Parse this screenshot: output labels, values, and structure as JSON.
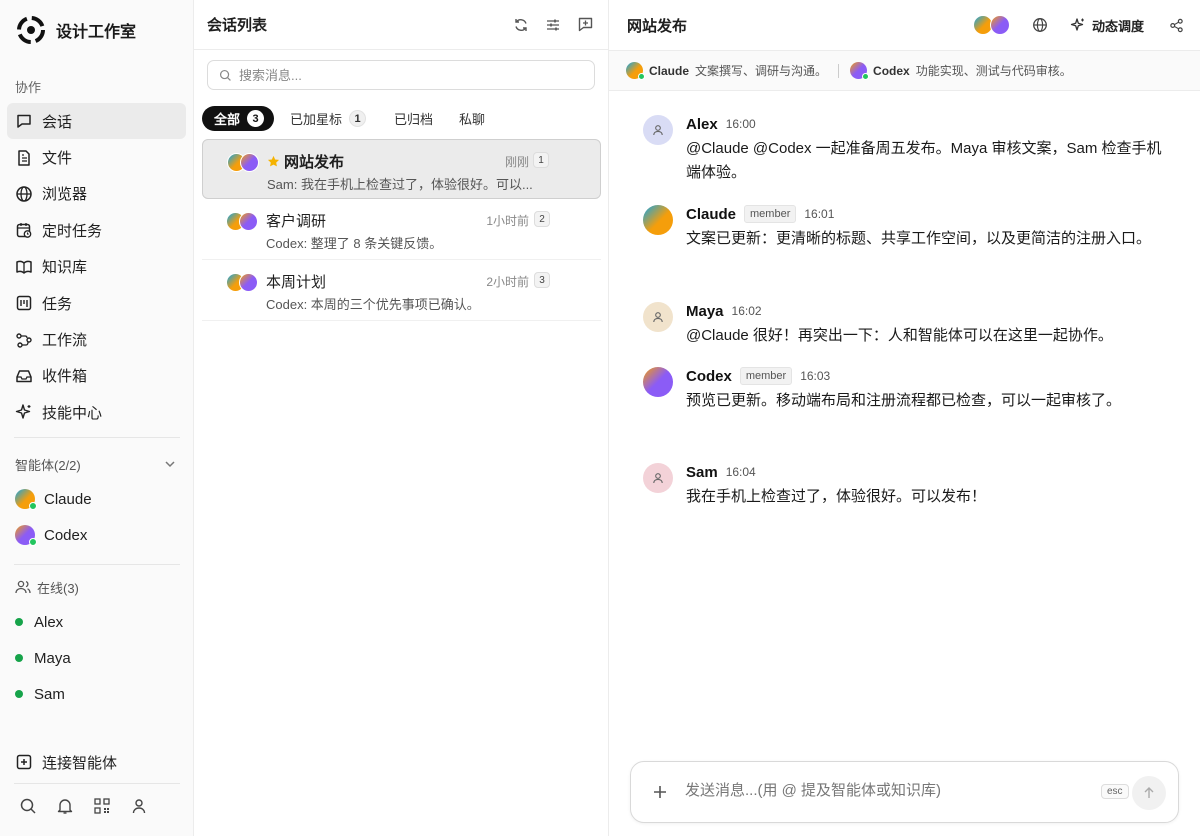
{
  "sidebar": {
    "brand": "设计工作室",
    "section_label": "协作",
    "nav": [
      {
        "label": "会话",
        "icon": "chat-icon"
      },
      {
        "label": "文件",
        "icon": "file-icon"
      },
      {
        "label": "浏览器",
        "icon": "globe-icon"
      },
      {
        "label": "定时任务",
        "icon": "calendar-clock-icon"
      },
      {
        "label": "知识库",
        "icon": "book-icon"
      },
      {
        "label": "任务",
        "icon": "kanban-icon"
      },
      {
        "label": "工作流",
        "icon": "workflow-icon"
      },
      {
        "label": "收件箱",
        "icon": "inbox-icon"
      },
      {
        "label": "技能中心",
        "icon": "sparkles-icon"
      }
    ],
    "agents_label": "智能体(2/2)",
    "agents": [
      {
        "name": "Claude",
        "color": "#f59e0b"
      },
      {
        "name": "Codex",
        "color": "#8b5cf6"
      }
    ],
    "online_label": "在线(3)",
    "online_users": [
      "Alex",
      "Maya",
      "Sam"
    ],
    "connect_label": "连接智能体"
  },
  "list": {
    "title": "会话列表",
    "search_placeholder": "搜索消息...",
    "tabs": [
      {
        "label": "全部",
        "count": "3"
      },
      {
        "label": "已加星标",
        "count": "1"
      },
      {
        "label": "已归档",
        "count": ""
      },
      {
        "label": "私聊",
        "count": ""
      }
    ],
    "conversations": [
      {
        "title": "网站发布",
        "preview": "Sam: 我在手机上检查过了，体验很好。可以...",
        "time": "刚刚",
        "count": "1",
        "starred": true
      },
      {
        "title": "客户调研",
        "preview": "Codex: 整理了 8 条关键反馈。",
        "time": "1小时前",
        "count": "2",
        "starred": false
      },
      {
        "title": "本周计划",
        "preview": "Codex: 本周的三个优先事项已确认。",
        "time": "2小时前",
        "count": "3",
        "starred": false
      }
    ]
  },
  "chat": {
    "title": "网站发布",
    "tool_label": "动态调度",
    "strip": [
      {
        "name": "Claude",
        "desc": "文案撰写、调研与沟通。"
      },
      {
        "name": "Codex",
        "desc": "功能实现、测试与代码审核。"
      }
    ],
    "messages": [
      {
        "name": "Alex",
        "role": "",
        "time": "16:00",
        "text": "@Claude @Codex 一起准备周五发布。Maya 审核文案，Sam 检查手机端体验。"
      },
      {
        "name": "Claude",
        "role": "member",
        "time": "16:01",
        "text": "文案已更新：更清晰的标题、共享工作空间，以及更简洁的注册入口。"
      },
      {
        "name": "Maya",
        "role": "",
        "time": "16:02",
        "text": "@Claude 很好！再突出一下：人和智能体可以在这里一起协作。"
      },
      {
        "name": "Codex",
        "role": "member",
        "time": "16:03",
        "text": "预览已更新。移动端布局和注册流程都已检查，可以一起审核了。"
      },
      {
        "name": "Sam",
        "role": "",
        "time": "16:04",
        "text": "我在手机上检查过了，体验很好。可以发布！"
      }
    ],
    "composer_placeholder": "发送消息...(用 @ 提及智能体或知识库)",
    "esc_label": "esc"
  },
  "colors": {
    "claude": "#f59e0b",
    "codex": "#8b5cf6",
    "online": "#22c55e",
    "alex_avatar": "#d9dcf5",
    "maya_avatar": "#f1e3cc",
    "sam_avatar": "#f3d2d8"
  }
}
